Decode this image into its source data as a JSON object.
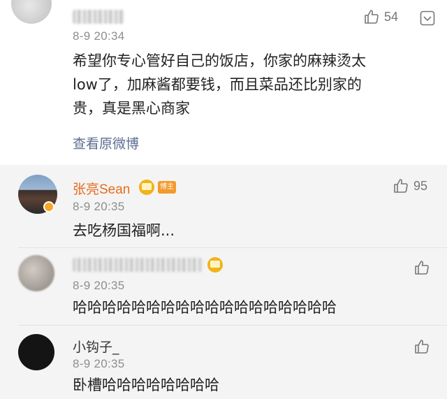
{
  "main_comment": {
    "time": "8-9 20:34",
    "text_lines": [
      "希望你专心管好自己的饭店，你家的麻辣烫太",
      "low了，加麻酱都要钱，而且菜品还比别家的",
      "贵，真是黑心商家"
    ],
    "view_original": "查看原微博",
    "like_count": "54",
    "icons": [
      "thumbs-up-icon",
      "more-icon"
    ]
  },
  "replies": [
    {
      "username": "张亮Sean",
      "badge": "博主",
      "time": "8-9 20:35",
      "text": "去吃杨国福啊...",
      "like_count": "95"
    },
    {
      "username": "",
      "time": "8-9 20:35",
      "text": "哈哈哈哈哈哈哈哈哈哈哈哈哈哈哈哈哈哈",
      "like_count": ""
    },
    {
      "username": "小钩子_",
      "time": "8-9 20:35",
      "text": "卧槽哈哈哈哈哈哈哈哈",
      "like_count": ""
    }
  ],
  "colors": {
    "username_accent": "#e86b1f",
    "link": "#5b6e91",
    "background": "#f4f4f4",
    "card": "#ffffff"
  }
}
